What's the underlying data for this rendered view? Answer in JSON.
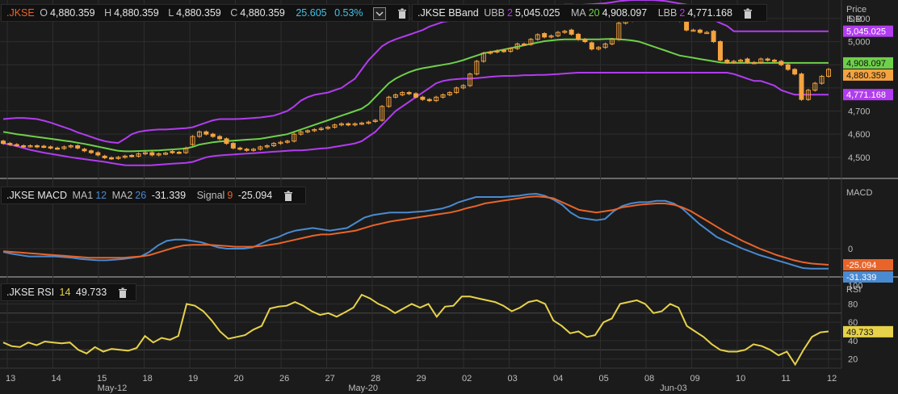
{
  "header_price": {
    "symbol": ".JKSE",
    "o_label": "O",
    "o": "4,880.359",
    "h_label": "H",
    "h": "4,880.359",
    "l_label": "L",
    "l": "4,880.359",
    "c_label": "C",
    "c": "4,880.359",
    "chg": "25.605",
    "chg_pct": "0.53%"
  },
  "header_bband": {
    "symbol": ".JKSE BBand",
    "ubb_label": "UBB",
    "ubb_n": "2",
    "ubb": "5,045.025",
    "ma_label": "MA",
    "ma_n": "20",
    "ma": "4,908.097",
    "lbb_label": "LBB",
    "lbb_n": "2",
    "lbb": "4,771.168"
  },
  "header_macd": {
    "symbol": ".JKSE MACD",
    "ma1_label": "MA1",
    "ma1": "12",
    "ma2_label": "MA2",
    "ma2": "26",
    "macd": "-31.339",
    "signal_label": "Signal",
    "signal_n": "9",
    "signal": "-25.094"
  },
  "header_rsi": {
    "symbol": ".JKSE RSI",
    "n": "14",
    "value": "49.733"
  },
  "axis_titles": {
    "price": "Price",
    "currency": "IDR",
    "macd": "MACD",
    "rsi": "RSI"
  },
  "colors": {
    "background": "#1b1b1b",
    "grid": "#2e2e2e",
    "up_candle": "#f4a340",
    "down_candle": "#f4a340",
    "upper_band": "#b23cf0",
    "middle_band": "#6ed04a",
    "lower_band": "#b23cf0",
    "macd_line": "#4a8ad0",
    "signal_line": "#e8642a",
    "rsi_line": "#e6d24a",
    "orange_label": "#e8642a",
    "green_label": "#6ed04a",
    "cyan_label": "#3fc2e8",
    "purple_label": "#b23cf0"
  },
  "chart_data": [
    {
      "type": "candlestick",
      "name": "price",
      "ylim": [
        4440,
        5180
      ],
      "yticks": [
        4500,
        4600,
        4700,
        4800,
        4900,
        5000,
        5100
      ],
      "ytick_labels": [
        "4,500",
        "4,600",
        "4,700",
        "",
        "",
        "5,000",
        "5,100"
      ],
      "x_labels": [
        "13",
        "14",
        "15",
        "18",
        "19",
        "20",
        "26",
        "27",
        "28",
        "29",
        "02",
        "03",
        "04",
        "05",
        "08",
        "09",
        "10",
        "11",
        "12"
      ],
      "x_sublabels": [
        {
          "text": "May-12",
          "at": 2.3
        },
        {
          "text": "May-20",
          "at": 7.8
        },
        {
          "text": "Jun-03",
          "at": 14.6
        }
      ],
      "close": [
        4560,
        4555,
        4552,
        4548,
        4550,
        4545,
        4545,
        4540,
        4538,
        4545,
        4550,
        4540,
        4528,
        4520,
        4510,
        4498,
        4495,
        4500,
        4505,
        4505,
        4515,
        4520,
        4510,
        4515,
        4518,
        4520,
        4520,
        4540,
        4590,
        4610,
        4600,
        4590,
        4580,
        4560,
        4540,
        4535,
        4530,
        4535,
        4545,
        4550,
        4560,
        4565,
        4570,
        4600,
        4610,
        4615,
        4620,
        4625,
        4630,
        4640,
        4645,
        4640,
        4645,
        4648,
        4652,
        4660,
        4720,
        4760,
        4770,
        4780,
        4775,
        4760,
        4750,
        4745,
        4760,
        4770,
        4780,
        4800,
        4810,
        4860,
        4915,
        4950,
        4955,
        4960,
        4958,
        4970,
        4990,
        4988,
        5010,
        5030,
        5020,
        5025,
        5040,
        5045,
        5032,
        5010,
        5000,
        4968,
        4975,
        4990,
        5010,
        5080,
        5090,
        5100,
        5110,
        5100,
        5100,
        5125,
        5130,
        5110,
        5090,
        5050,
        5050,
        5040,
        5040,
        5000,
        4920,
        4910,
        4915,
        4920,
        4910,
        4910,
        4925,
        4920,
        4915,
        4900,
        4880,
        4860,
        4750,
        4790,
        4820,
        4850,
        4880
      ],
      "open": [
        4570,
        4560,
        4555,
        4550,
        4548,
        4550,
        4548,
        4545,
        4540,
        4538,
        4545,
        4550,
        4535,
        4528,
        4520,
        4505,
        4498,
        4495,
        4500,
        4508,
        4505,
        4515,
        4520,
        4510,
        4515,
        4525,
        4522,
        4520,
        4555,
        4590,
        4610,
        4600,
        4590,
        4580,
        4560,
        4540,
        4535,
        4530,
        4535,
        4545,
        4550,
        4560,
        4565,
        4570,
        4600,
        4610,
        4615,
        4620,
        4625,
        4630,
        4640,
        4645,
        4640,
        4645,
        4648,
        4655,
        4660,
        4720,
        4760,
        4770,
        4780,
        4775,
        4760,
        4750,
        4745,
        4760,
        4770,
        4780,
        4800,
        4810,
        4860,
        4915,
        4950,
        4955,
        4962,
        4958,
        4970,
        4990,
        4988,
        5010,
        5035,
        5020,
        5025,
        5040,
        5050,
        5032,
        5010,
        4995,
        4968,
        4975,
        4990,
        5010,
        5080,
        5090,
        5100,
        5112,
        5100,
        5100,
        5125,
        5130,
        5110,
        5090,
        5050,
        5050,
        5040,
        5045,
        5000,
        4920,
        4910,
        4915,
        4925,
        4910,
        4910,
        4925,
        4920,
        4915,
        4900,
        4880,
        4860,
        4750,
        4790,
        4820,
        4850
      ],
      "series": [
        {
          "name": "UBB",
          "values": [
            4665,
            4668,
            4670,
            4670,
            4668,
            4665,
            4658,
            4650,
            4640,
            4630,
            4620,
            4608,
            4598,
            4588,
            4578,
            4570,
            4565,
            4562,
            4580,
            4600,
            4610,
            4615,
            4618,
            4620,
            4620,
            4622,
            4624,
            4626,
            4630,
            4640,
            4650,
            4660,
            4665,
            4665,
            4665,
            4666,
            4668,
            4670,
            4672,
            4676,
            4680,
            4690,
            4700,
            4720,
            4745,
            4760,
            4770,
            4775,
            4780,
            4790,
            4800,
            4820,
            4840,
            4880,
            4920,
            4950,
            4980,
            4998,
            5010,
            5020,
            5030,
            5040,
            5050,
            5065,
            5075,
            5085,
            5090,
            5095,
            5095,
            5095,
            5100,
            5110,
            5120,
            5130,
            5140,
            5142,
            5145,
            5145,
            5145,
            5148,
            5150,
            5152,
            5155,
            5160,
            5160,
            5158,
            5160,
            5162,
            5164,
            5166,
            5170,
            5175,
            5178,
            5180,
            5180,
            5180,
            5180,
            5178,
            5175,
            5170,
            5165,
            5160,
            5150,
            5140,
            5120,
            5095,
            5080,
            5068,
            5045,
            5045,
            5045,
            5045,
            5045,
            5045,
            5045,
            5045,
            5045,
            5045,
            5045,
            5045,
            5045,
            5045,
            5045
          ]
        },
        {
          "name": "MA 20",
          "values": [
            4610,
            4605,
            4600,
            4596,
            4592,
            4588,
            4584,
            4580,
            4576,
            4572,
            4568,
            4563,
            4558,
            4552,
            4546,
            4540,
            4534,
            4528,
            4526,
            4526,
            4527,
            4528,
            4529,
            4530,
            4532,
            4534,
            4536,
            4538,
            4545,
            4555,
            4560,
            4565,
            4568,
            4570,
            4572,
            4574,
            4576,
            4578,
            4580,
            4585,
            4590,
            4595,
            4600,
            4610,
            4620,
            4630,
            4640,
            4650,
            4660,
            4670,
            4680,
            4690,
            4700,
            4710,
            4730,
            4760,
            4790,
            4820,
            4840,
            4855,
            4868,
            4878,
            4885,
            4890,
            4895,
            4900,
            4905,
            4912,
            4920,
            4930,
            4940,
            4950,
            4955,
            4960,
            4966,
            4972,
            4978,
            4984,
            4990,
            4996,
            5002,
            5005,
            5008,
            5010,
            5010,
            5010,
            5010,
            5010,
            5010,
            5011,
            5012,
            5010,
            5008,
            5005,
            5000,
            4990,
            4980,
            4970,
            4960,
            4950,
            4940,
            4935,
            4930,
            4925,
            4920,
            4915,
            4910,
            4908,
            4908,
            4908,
            4908,
            4908,
            4908,
            4908,
            4908,
            4908,
            4908,
            4908,
            4908,
            4908,
            4908,
            4908,
            4908
          ]
        },
        {
          "name": "LBB",
          "values": [
            4560,
            4555,
            4548,
            4540,
            4532,
            4526,
            4520,
            4515,
            4510,
            4505,
            4500,
            4496,
            4492,
            4488,
            4484,
            4480,
            4475,
            4470,
            4466,
            4465,
            4465,
            4465,
            4466,
            4468,
            4470,
            4472,
            4474,
            4476,
            4480,
            4490,
            4500,
            4505,
            4508,
            4510,
            4512,
            4514,
            4516,
            4518,
            4520,
            4522,
            4524,
            4526,
            4528,
            4530,
            4530,
            4532,
            4535,
            4538,
            4540,
            4545,
            4550,
            4555,
            4560,
            4570,
            4590,
            4610,
            4640,
            4670,
            4700,
            4720,
            4740,
            4760,
            4780,
            4800,
            4820,
            4830,
            4835,
            4838,
            4840,
            4840,
            4842,
            4845,
            4848,
            4850,
            4852,
            4852,
            4853,
            4855,
            4855,
            4856,
            4856,
            4858,
            4860,
            4862,
            4864,
            4866,
            4866,
            4866,
            4866,
            4866,
            4866,
            4866,
            4866,
            4866,
            4866,
            4866,
            4866,
            4866,
            4866,
            4866,
            4866,
            4866,
            4866,
            4866,
            4866,
            4866,
            4866,
            4866,
            4860,
            4850,
            4840,
            4830,
            4830,
            4820,
            4810,
            4790,
            4780,
            4771,
            4771,
            4771,
            4771,
            4771,
            4771
          ]
        }
      ],
      "last_labels": [
        {
          "text": "5,045.025",
          "value": 5045,
          "color": "#b23cf0"
        },
        {
          "text": "4,908.097",
          "value": 4908,
          "color": "#6ed04a"
        },
        {
          "text": "4,880.359",
          "value": 4880,
          "color": "#f4a340"
        },
        {
          "text": "4,771.168",
          "value": 4771,
          "color": "#b23cf0"
        }
      ]
    },
    {
      "type": "line",
      "name": "macd",
      "ylim": [
        -40,
        100
      ],
      "yticks": [
        0
      ],
      "ytick_labels": [
        "0"
      ],
      "series": [
        {
          "name": "MA1",
          "values": [
            -5,
            -8,
            -10,
            -12,
            -12,
            -12,
            -12,
            -13,
            -14,
            -16,
            -17,
            -18,
            -18,
            -17,
            -16,
            -14,
            -12,
            -5,
            5,
            12,
            14,
            14,
            12,
            10,
            6,
            2,
            0,
            0,
            0,
            2,
            8,
            14,
            18,
            24,
            28,
            30,
            32,
            30,
            28,
            30,
            32,
            40,
            48,
            52,
            54,
            56,
            56,
            56,
            57,
            58,
            60,
            62,
            66,
            72,
            76,
            80,
            80,
            80,
            80,
            81,
            82,
            84,
            85,
            82,
            76,
            68,
            56,
            48,
            46,
            44,
            46,
            58,
            66,
            70,
            72,
            72,
            74,
            74,
            70,
            62,
            50,
            38,
            28,
            18,
            12,
            6,
            0,
            -5,
            -10,
            -14,
            -18,
            -22,
            -26,
            -30,
            -31,
            -31,
            -31
          ]
        },
        {
          "name": "Signal",
          "values": [
            -4,
            -5,
            -6,
            -7,
            -8,
            -9,
            -10,
            -11,
            -12,
            -13,
            -14,
            -14,
            -14,
            -14,
            -14,
            -13,
            -12,
            -10,
            -6,
            -2,
            2,
            5,
            6,
            6,
            6,
            5,
            4,
            3,
            3,
            3,
            4,
            6,
            8,
            11,
            14,
            17,
            20,
            22,
            22,
            24,
            26,
            28,
            32,
            36,
            39,
            42,
            44,
            46,
            48,
            50,
            52,
            54,
            56,
            59,
            63,
            66,
            70,
            72,
            74,
            76,
            78,
            80,
            81,
            80,
            78,
            72,
            66,
            60,
            58,
            56,
            58,
            60,
            64,
            66,
            68,
            69,
            70,
            70,
            68,
            64,
            58,
            50,
            42,
            34,
            26,
            19,
            12,
            6,
            0,
            -5,
            -10,
            -14,
            -18,
            -21,
            -23,
            -24,
            -25
          ]
        }
      ],
      "last_labels": [
        {
          "text": "-25.094",
          "value": -25,
          "color": "#e8642a"
        },
        {
          "text": "-31.339",
          "value": -31,
          "color": "#4a8ad0"
        }
      ]
    },
    {
      "type": "line",
      "name": "rsi",
      "ylim": [
        10,
        105
      ],
      "yticks": [
        20,
        40,
        60,
        80,
        100
      ],
      "ytick_labels": [
        "20",
        "40",
        "60",
        "80",
        "100"
      ],
      "series": [
        {
          "name": "RSI 14",
          "values": [
            38,
            34,
            33,
            38,
            35,
            39,
            38,
            37,
            38,
            30,
            26,
            33,
            28,
            31,
            30,
            29,
            32,
            45,
            38,
            43,
            41,
            45,
            80,
            78,
            72,
            62,
            50,
            42,
            44,
            46,
            52,
            56,
            75,
            77,
            78,
            82,
            78,
            72,
            68,
            70,
            66,
            71,
            76,
            90,
            86,
            80,
            76,
            70,
            75,
            80,
            76,
            80,
            66,
            77,
            78,
            88,
            88,
            86,
            84,
            82,
            78,
            72,
            76,
            82,
            84,
            80,
            62,
            56,
            48,
            50,
            44,
            46,
            60,
            64,
            80,
            82,
            84,
            80,
            70,
            72,
            80,
            76,
            56,
            50,
            44,
            36,
            30,
            28,
            28,
            30,
            36,
            34,
            30,
            24,
            28,
            14,
            30,
            44,
            49,
            50
          ]
        }
      ],
      "last_labels": [
        {
          "text": "49.733",
          "value": 49.7,
          "color": "#e6d24a"
        }
      ]
    }
  ]
}
